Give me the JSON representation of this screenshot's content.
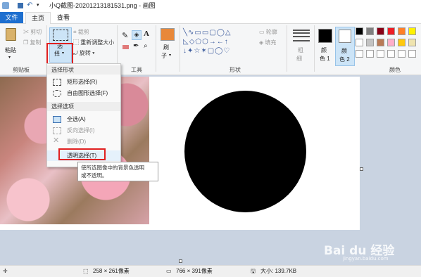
{
  "window": {
    "title": "小Q截图-20201213181531.png - 画图"
  },
  "tabs": [
    {
      "label": "文件"
    },
    {
      "label": "主页"
    },
    {
      "label": "查看"
    }
  ],
  "ribbon": {
    "clipboard": {
      "paste": "粘贴",
      "cut": "剪切",
      "copy": "复制",
      "group_label": "剪贴板"
    },
    "image": {
      "select_line1": "选",
      "select_line2": "择",
      "crop": "裁剪",
      "resize": "重新调整大小",
      "rotate": "旋转"
    },
    "tools": {
      "group_label": "工具"
    },
    "brushes": {
      "line1": "刷",
      "line2": "子"
    },
    "shapes": {
      "outline": "轮廓",
      "fill": "填充",
      "group_label": "形状"
    },
    "size": {
      "line1": "粗",
      "line2": "细"
    },
    "color1": {
      "line1": "颜",
      "line2": "色 1"
    },
    "color2": {
      "line1": "颜",
      "line2": "色 2"
    },
    "colors": {
      "group_label": "颜色"
    },
    "palette": [
      "#000000",
      "#7f7f7f",
      "#880015",
      "#ed1c24",
      "#ff7f27",
      "#fff200",
      "#ffffff",
      "#c3c3c3",
      "#b97a57",
      "#ffaec9",
      "#ffc90e",
      "#efe4b0"
    ]
  },
  "select_menu": {
    "shapes_header": "选择形状",
    "rect_select": "矩形选择(R)",
    "free_select": "自由图形选择(F)",
    "options_header": "选择选项",
    "select_all": "全选(A)",
    "invert": "反向选择(I)",
    "delete": "删除(D)",
    "transparent": "透明选择(T)"
  },
  "tooltip": {
    "line1": "使所选图像中的背景色透明",
    "line2": "或不透明。"
  },
  "status": {
    "cursor": "",
    "selection": "258 × 261像素",
    "image_size": "766 × 391像素",
    "file_size": "大小: 139.7KB"
  },
  "watermark": {
    "brand": "Bai du 经验",
    "url": "jingyan.baidu.com"
  },
  "highlight_color": "#e02020"
}
